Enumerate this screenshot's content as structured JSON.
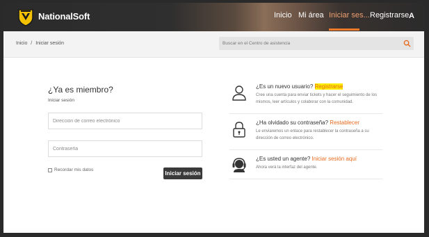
{
  "header": {
    "brand": "NationalSoft",
    "nav": [
      {
        "label": "Inicio",
        "active": false
      },
      {
        "label": "Mi área",
        "active": false
      },
      {
        "label": "Iniciar ses...",
        "active": true
      },
      {
        "label": "Registrarse",
        "active": false
      }
    ],
    "lang_icon": "A",
    "accent": "#f07a2a"
  },
  "breadcrumb": {
    "home": "Inicio",
    "separator": "/",
    "current": "Iniciar sesión"
  },
  "search": {
    "placeholder": "Buscar en el Centro de asistencia",
    "icon": "search-icon"
  },
  "login": {
    "title": "¿Ya es miembro?",
    "subtitle": "Iniciar sesión",
    "email_placeholder": "Dirección de correo electrónico",
    "password_placeholder": "Contraseña",
    "remember_label": "Recordar mis datos",
    "submit_label": "Iniciar sesión"
  },
  "info": {
    "register": {
      "question": "¿Es un nuevo usuario?",
      "link": "Registrarse",
      "desc": "Cree una cuenta para enviar tickets y hacer el seguimiento de los mismos, leer artículos y colaborar con la comunidad.",
      "icon": "user-icon"
    },
    "reset": {
      "question": "¿Ha olvidado su contraseña?",
      "link": "Restablecer",
      "desc": "Le enviaremos un enlace para restablecer la contraseña a su dirección de correo electrónico.",
      "icon": "lock-icon"
    },
    "agent": {
      "question": "¿Es usted un agente?",
      "link": "Iniciar sesión aquí",
      "desc": "Ahora verá la interfaz del agente.",
      "icon": "headset-icon"
    }
  }
}
